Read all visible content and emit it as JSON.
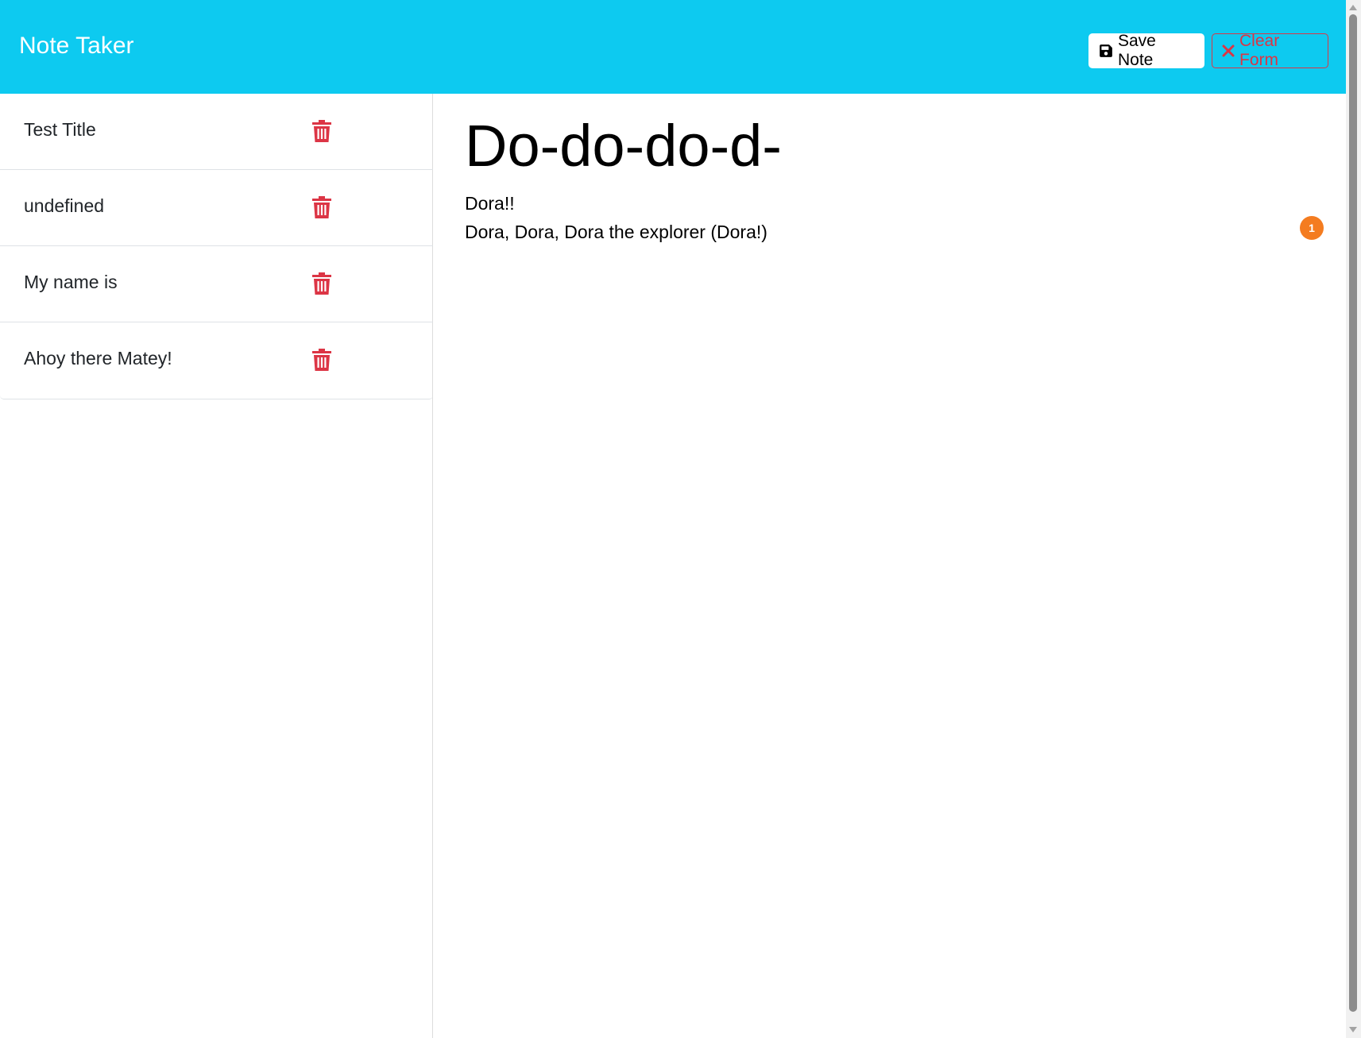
{
  "app": {
    "brand": "Note Taker"
  },
  "toolbar": {
    "save_label": "Save Note",
    "clear_label": "Clear Form",
    "save_icon": "floppy-disk-icon",
    "clear_icon": "close-x-icon"
  },
  "notes": [
    {
      "title": "Test Title"
    },
    {
      "title": "undefined"
    },
    {
      "title": "My name is"
    },
    {
      "title": "Ahoy there Matey!"
    }
  ],
  "editor": {
    "title": "Do-do-do-d-",
    "body": "Dora!!\nDora, Dora, Dora the explorer (Dora!)"
  },
  "badge": {
    "count": "1"
  },
  "colors": {
    "navbar": "#0dcaf0",
    "danger": "#dc3545",
    "badge": "#f47c20"
  }
}
